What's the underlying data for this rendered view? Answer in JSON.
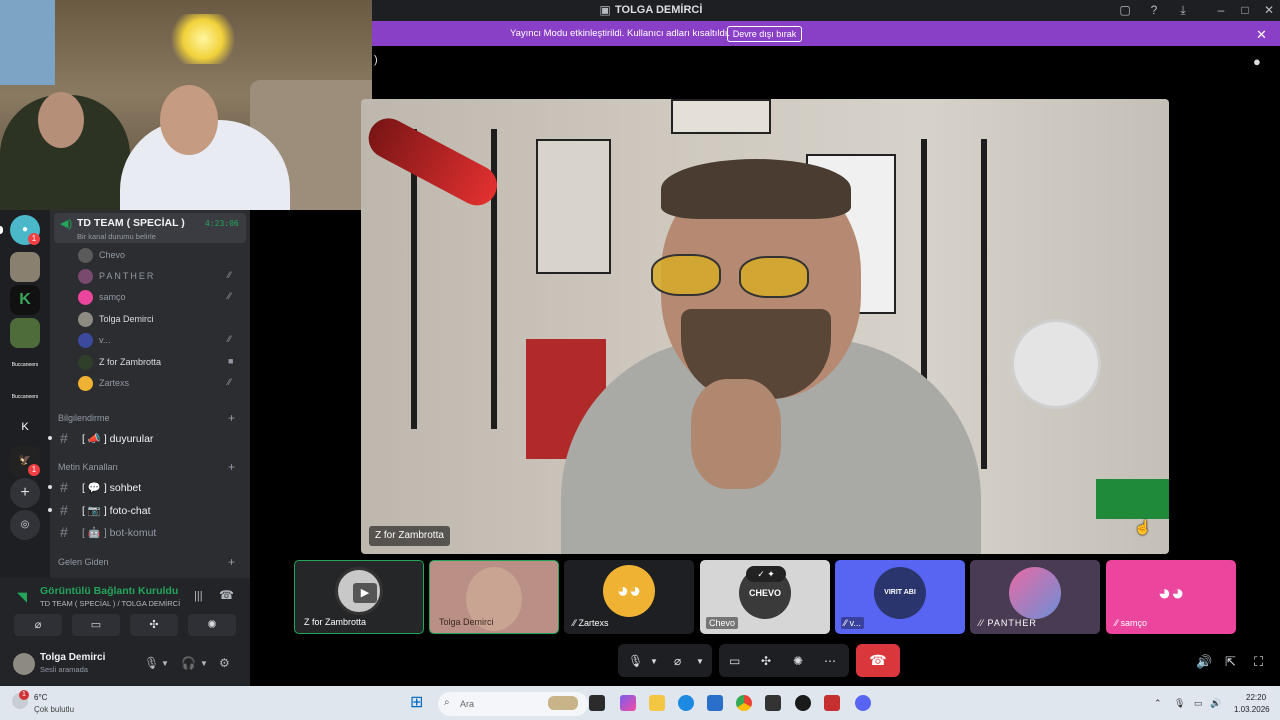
{
  "window": {
    "title": "TOLGA DEMİRCİ"
  },
  "streamer_bar": {
    "message": "Yayıncı Modu etkinleştirildi. Kullanıcı adları kısaltıldı.",
    "disable_label": "Devre dışı bırak"
  },
  "voice_channel": {
    "name": "TD TEAM ( SPECİAL )",
    "timer": "4:23:06",
    "status_placeholder": "Bir kanal durumu belirle",
    "members": [
      {
        "name": "Chevo",
        "avatar_color": "#5a5a5a",
        "icon": ""
      },
      {
        "name": "PANTHER",
        "avatar_color": "#7a4a6e",
        "icon": "muted-mic-icon"
      },
      {
        "name": "samço",
        "avatar_color": "#eb459e",
        "icon": "muted-mic-icon"
      },
      {
        "name": "Tolga Demirci",
        "avatar_color": "#8d8a82",
        "icon": ""
      },
      {
        "name": "v...",
        "avatar_color": "#3b4a9c",
        "icon": "muted-mic-icon"
      },
      {
        "name": "Z for Zambrotta",
        "avatar_color": "#2f3f2a",
        "icon": "video-icon"
      },
      {
        "name": "Zartexs",
        "avatar_color": "#f0b232",
        "icon": "muted-mic-icon"
      }
    ]
  },
  "categories": {
    "bilgilendirme": "Bilgilendirme",
    "metin": "Metin Kanalları",
    "gelen_giden": "Gelen Giden"
  },
  "channels": {
    "duyurular": "[ 📣 ] duyurular",
    "sohbet": "[ 💬 ] sohbet",
    "foto_chat": "[ 📷 ] foto-chat",
    "bot_komut": "[ 🤖 ] bot-komut"
  },
  "voice_panel": {
    "title": "Görüntülü Bağlantı Kuruldu",
    "subtitle": "TD TEAM ( SPECİAL ) / TOLGA DEMİRCİ"
  },
  "user": {
    "name": "Tolga Demirci",
    "status": "Sesli aramada"
  },
  "servers": {
    "badges": [
      "1",
      "1"
    ],
    "texts": [
      "K",
      "Buccaneers",
      "Buccaneers"
    ]
  },
  "main_video": {
    "label": "Z for Zambrotta"
  },
  "tiles": [
    {
      "label": "Z for Zambrotta",
      "bg": "#242628",
      "selected": true
    },
    {
      "label": "Tolga Demirci",
      "bg": "#b98f86",
      "selected": true
    },
    {
      "label": "Zartexs",
      "bg": "#1e1f22",
      "muted": true
    },
    {
      "label": "Chevo",
      "bg": "#d6d6d6"
    },
    {
      "label": "v...",
      "bg": "#5865f2",
      "muted": true,
      "avatar_text": "VIRIT ABI"
    },
    {
      "label": "PANTHER",
      "bg": "#4a3b54",
      "muted": true
    },
    {
      "label": "samço",
      "bg": "#eb459e",
      "muted": true
    }
  ],
  "taskbar": {
    "weather_temp": "6°C",
    "weather_desc": "Çok bulutlu",
    "weather_badge": "1",
    "search_placeholder": "Ara",
    "time": "22:20",
    "date": "1.03.2026"
  },
  "colors": {
    "accent_green": "#23a55a",
    "streamer_purple": "#8a3fc7",
    "hangup_red": "#da373c",
    "blurple": "#5865f2"
  }
}
